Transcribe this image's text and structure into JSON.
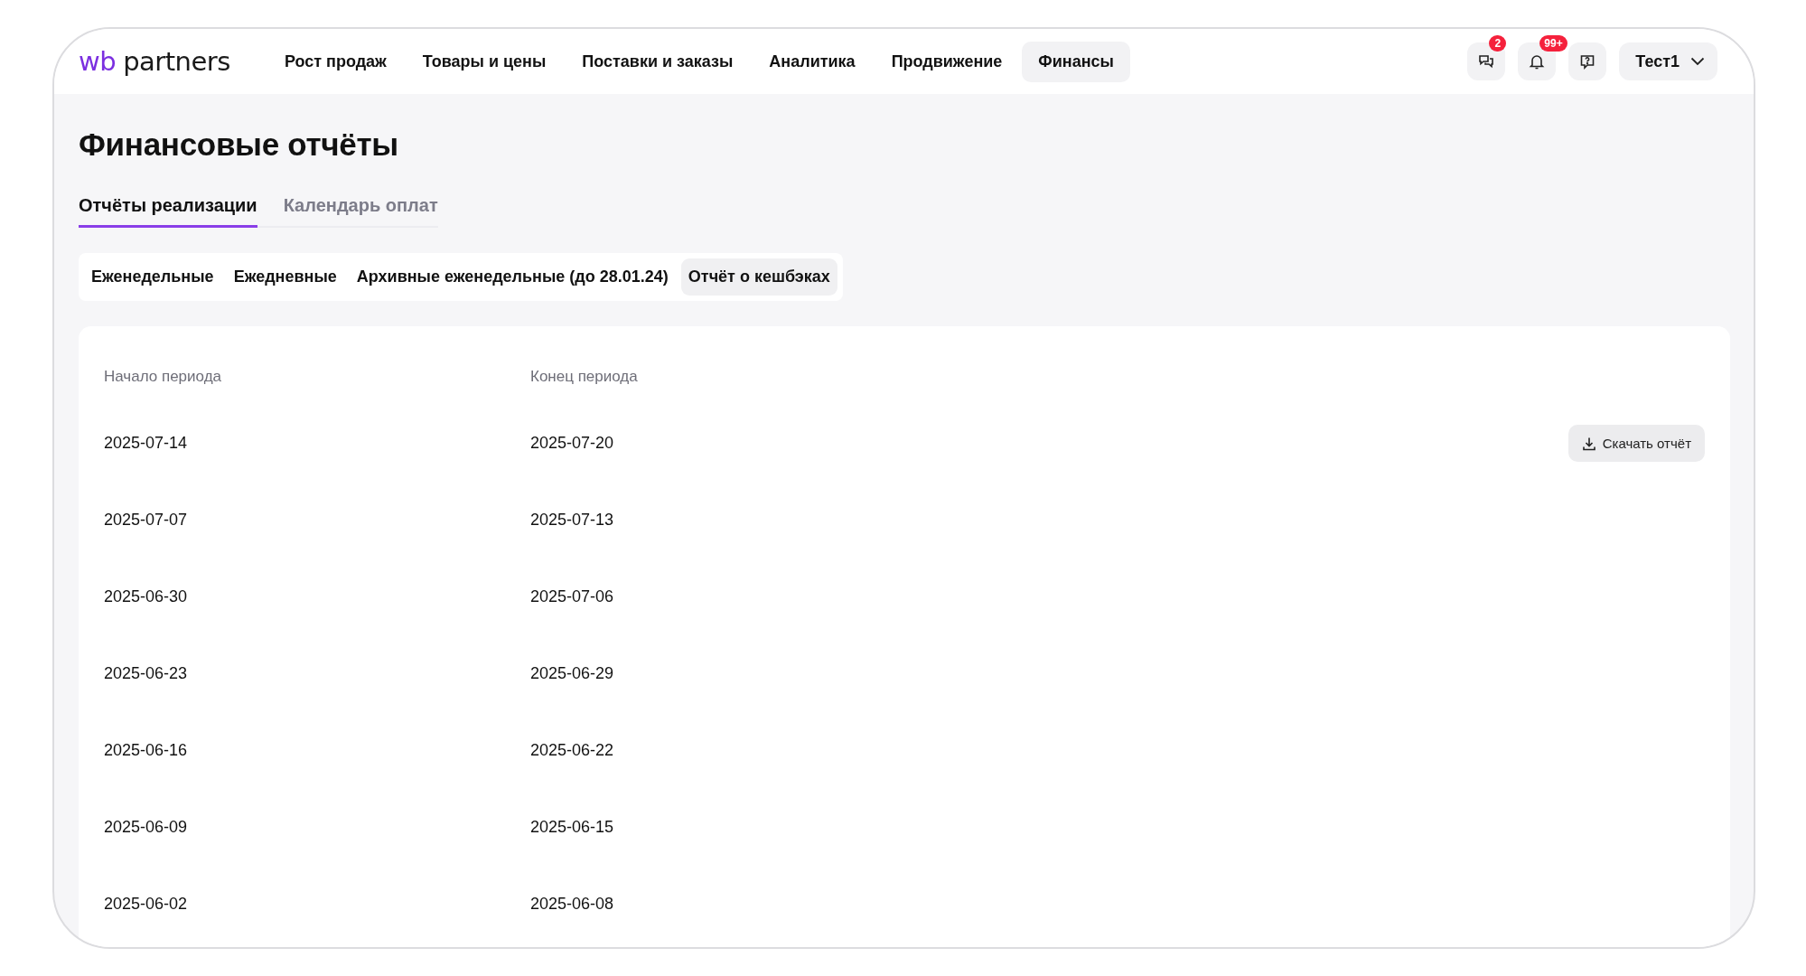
{
  "header": {
    "logo": {
      "brand": "wb",
      "product": "partners"
    },
    "nav": [
      {
        "label": "Рост продаж",
        "selected": false
      },
      {
        "label": "Товары и цены",
        "selected": false
      },
      {
        "label": "Поставки и заказы",
        "selected": false
      },
      {
        "label": "Аналитика",
        "selected": false
      },
      {
        "label": "Продвижение",
        "selected": false
      },
      {
        "label": "Финансы",
        "selected": true
      }
    ],
    "actions": [
      {
        "kind": "chat",
        "badge": "2"
      },
      {
        "kind": "bell",
        "badge": "99+"
      },
      {
        "kind": "help"
      }
    ],
    "user": "Тест1"
  },
  "page": {
    "title": "Финансовые отчёты",
    "tabs": [
      {
        "label": "Отчёты реализации",
        "selected": true
      },
      {
        "label": "Календарь оплат",
        "selected": false
      }
    ],
    "subtabs": [
      {
        "label": "Еженедельные",
        "selected": false
      },
      {
        "label": "Ежедневные",
        "selected": false
      },
      {
        "label": "Архивные еженедельные (до 28.01.24)",
        "selected": false
      },
      {
        "label": "Отчёт о кешбэках",
        "selected": true
      }
    ],
    "table": {
      "columns": [
        "Начало периода",
        "Конец периода"
      ],
      "rows": [
        {
          "start": "2025-07-14",
          "end": "2025-07-20",
          "action": "Скачать отчёт"
        },
        {
          "start": "2025-07-07",
          "end": "2025-07-13"
        },
        {
          "start": "2025-06-30",
          "end": "2025-07-06"
        },
        {
          "start": "2025-06-23",
          "end": "2025-06-29"
        },
        {
          "start": "2025-06-16",
          "end": "2025-06-22"
        },
        {
          "start": "2025-06-09",
          "end": "2025-06-15"
        },
        {
          "start": "2025-06-02",
          "end": "2025-06-08"
        }
      ]
    }
  }
}
